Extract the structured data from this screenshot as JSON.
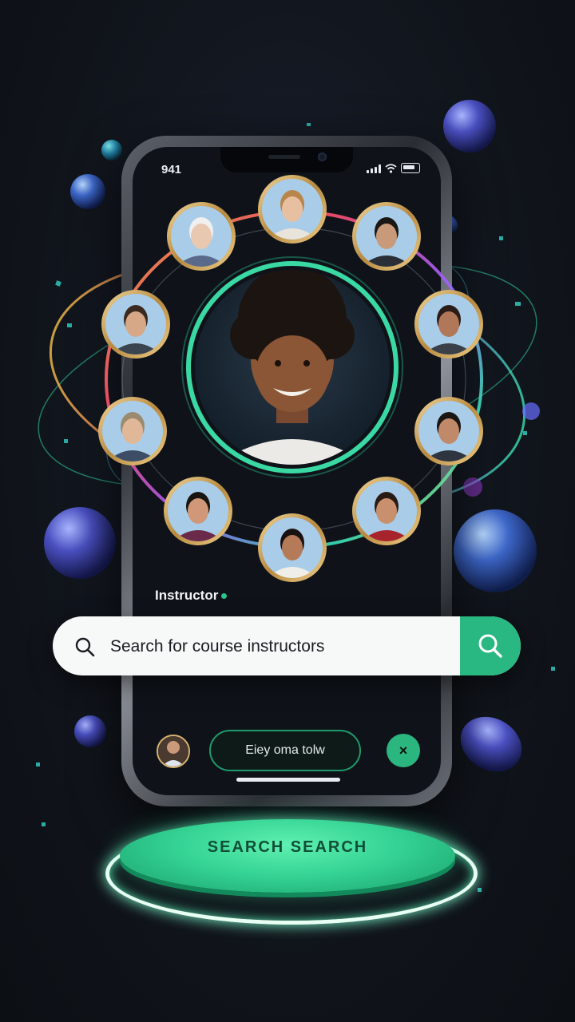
{
  "status_bar": {
    "time": "941"
  },
  "section_label": "Instructor",
  "search": {
    "placeholder": "Search for course instructors"
  },
  "bottom_bar": {
    "pill_label": "Eiey oma tolw",
    "close_symbol": "×"
  },
  "pedestal_label": "SEARCH SEARCH",
  "colors": {
    "background": "#11151c",
    "accent_green": "#2ab882",
    "ring_gold": "#d8b370"
  },
  "icons": [
    "search-icon",
    "wifi-icon",
    "battery-icon",
    "signal-icon",
    "close-icon",
    "instructor-avatar",
    "featured-instructor-avatar"
  ]
}
